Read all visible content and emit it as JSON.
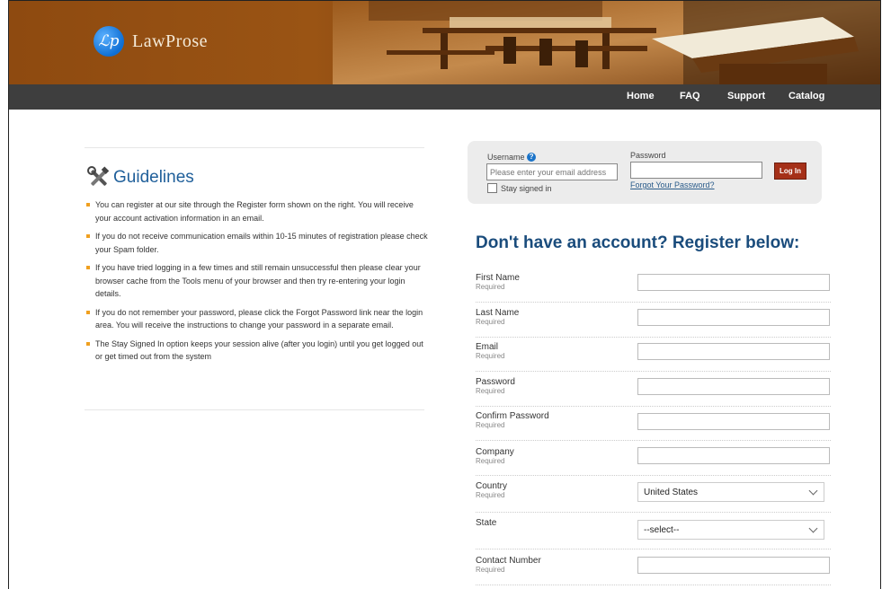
{
  "brand": {
    "logo_initials": "ℒp",
    "name": "LawProse"
  },
  "nav": {
    "home": "Home",
    "faq": "FAQ",
    "support": "Support",
    "catalog": "Catalog"
  },
  "guidelines": {
    "title": "Guidelines",
    "items": [
      "You can register at our site through the Register form shown on the right. You will receive your account activation information in an email.",
      "If you do not receive communication emails within 10-15 minutes of registration please check your Spam folder.",
      "If you have tried logging in a few times and still remain unsuccessful then please clear your browser cache from the Tools menu of your browser and then try re-entering your login details.",
      "If you do not remember your password, please click the Forgot Password link near the login area. You will receive the instructions to change your password in a separate email.",
      "The Stay Signed In option keeps your session alive (after you login) until you get logged out or get timed out from the system"
    ]
  },
  "login": {
    "username_label": "Username",
    "help_glyph": "?",
    "username_placeholder": "Please enter your email address",
    "password_label": "Password",
    "stay_signed_in": "Stay signed in",
    "forgot_password": "Forgot Your Password?",
    "login_button": "Log In"
  },
  "register": {
    "title": "Don't have an account? Register below:",
    "fields": [
      {
        "name": "First Name",
        "required": "Required"
      },
      {
        "name": "Last Name",
        "required": "Required"
      },
      {
        "name": "Email",
        "required": "Required"
      },
      {
        "name": "Password",
        "required": "Required"
      },
      {
        "name": "Confirm Password",
        "required": "Required"
      },
      {
        "name": "Company",
        "required": "Required"
      },
      {
        "name": "Country",
        "required": "Required",
        "value": "United States"
      },
      {
        "name": "State",
        "value": "--select--"
      },
      {
        "name": "Contact Number",
        "required": "Required"
      }
    ]
  },
  "colors": {
    "header_brown": "#8e4a10",
    "nav_bg": "#3e3e3e",
    "title_blue": "#1a4c7c",
    "login_button": "#a53018",
    "bullet": "#f0a020"
  }
}
